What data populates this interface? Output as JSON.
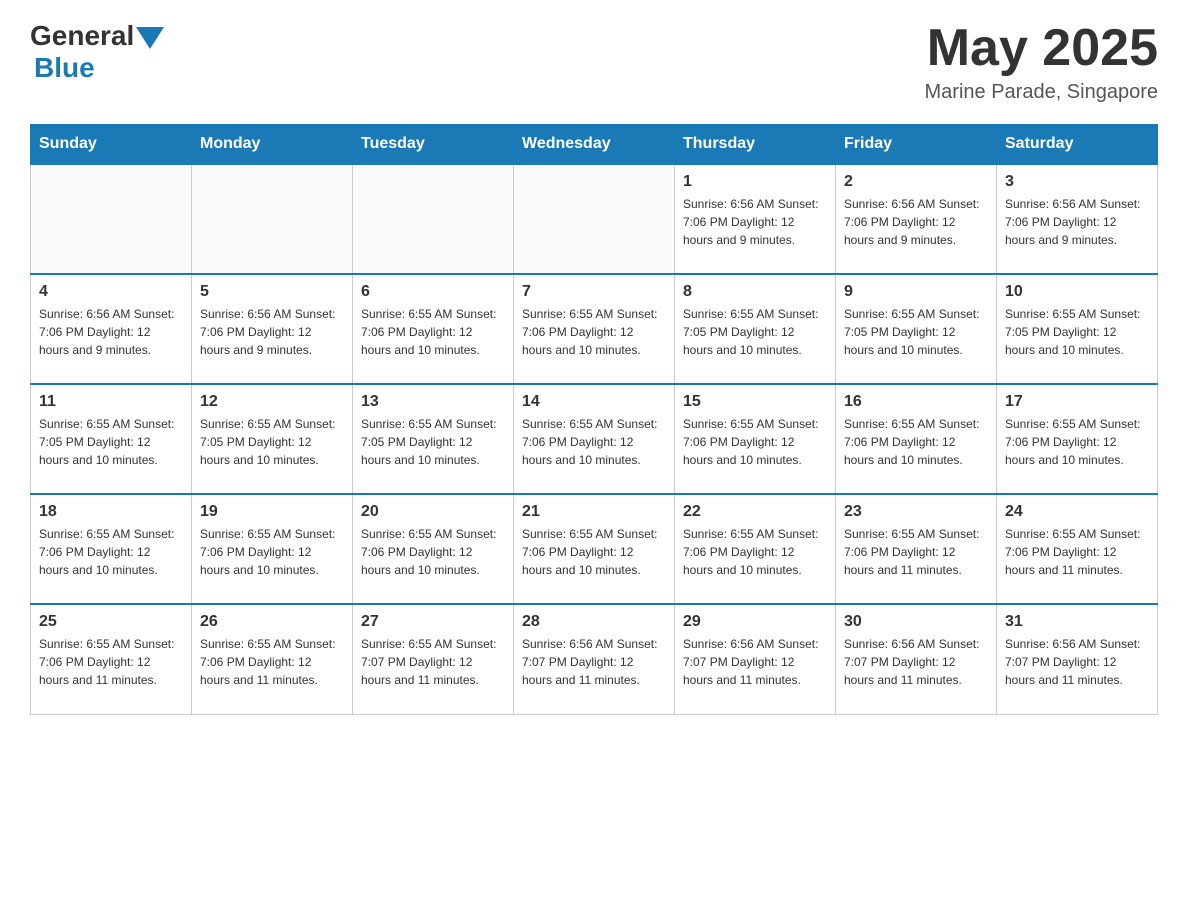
{
  "header": {
    "logo_general": "General",
    "logo_blue": "Blue",
    "month_title": "May 2025",
    "location": "Marine Parade, Singapore"
  },
  "weekdays": [
    "Sunday",
    "Monday",
    "Tuesday",
    "Wednesday",
    "Thursday",
    "Friday",
    "Saturday"
  ],
  "weeks": [
    [
      {
        "day": "",
        "info": ""
      },
      {
        "day": "",
        "info": ""
      },
      {
        "day": "",
        "info": ""
      },
      {
        "day": "",
        "info": ""
      },
      {
        "day": "1",
        "info": "Sunrise: 6:56 AM\nSunset: 7:06 PM\nDaylight: 12 hours and 9 minutes."
      },
      {
        "day": "2",
        "info": "Sunrise: 6:56 AM\nSunset: 7:06 PM\nDaylight: 12 hours and 9 minutes."
      },
      {
        "day": "3",
        "info": "Sunrise: 6:56 AM\nSunset: 7:06 PM\nDaylight: 12 hours and 9 minutes."
      }
    ],
    [
      {
        "day": "4",
        "info": "Sunrise: 6:56 AM\nSunset: 7:06 PM\nDaylight: 12 hours and 9 minutes."
      },
      {
        "day": "5",
        "info": "Sunrise: 6:56 AM\nSunset: 7:06 PM\nDaylight: 12 hours and 9 minutes."
      },
      {
        "day": "6",
        "info": "Sunrise: 6:55 AM\nSunset: 7:06 PM\nDaylight: 12 hours and 10 minutes."
      },
      {
        "day": "7",
        "info": "Sunrise: 6:55 AM\nSunset: 7:06 PM\nDaylight: 12 hours and 10 minutes."
      },
      {
        "day": "8",
        "info": "Sunrise: 6:55 AM\nSunset: 7:05 PM\nDaylight: 12 hours and 10 minutes."
      },
      {
        "day": "9",
        "info": "Sunrise: 6:55 AM\nSunset: 7:05 PM\nDaylight: 12 hours and 10 minutes."
      },
      {
        "day": "10",
        "info": "Sunrise: 6:55 AM\nSunset: 7:05 PM\nDaylight: 12 hours and 10 minutes."
      }
    ],
    [
      {
        "day": "11",
        "info": "Sunrise: 6:55 AM\nSunset: 7:05 PM\nDaylight: 12 hours and 10 minutes."
      },
      {
        "day": "12",
        "info": "Sunrise: 6:55 AM\nSunset: 7:05 PM\nDaylight: 12 hours and 10 minutes."
      },
      {
        "day": "13",
        "info": "Sunrise: 6:55 AM\nSunset: 7:05 PM\nDaylight: 12 hours and 10 minutes."
      },
      {
        "day": "14",
        "info": "Sunrise: 6:55 AM\nSunset: 7:06 PM\nDaylight: 12 hours and 10 minutes."
      },
      {
        "day": "15",
        "info": "Sunrise: 6:55 AM\nSunset: 7:06 PM\nDaylight: 12 hours and 10 minutes."
      },
      {
        "day": "16",
        "info": "Sunrise: 6:55 AM\nSunset: 7:06 PM\nDaylight: 12 hours and 10 minutes."
      },
      {
        "day": "17",
        "info": "Sunrise: 6:55 AM\nSunset: 7:06 PM\nDaylight: 12 hours and 10 minutes."
      }
    ],
    [
      {
        "day": "18",
        "info": "Sunrise: 6:55 AM\nSunset: 7:06 PM\nDaylight: 12 hours and 10 minutes."
      },
      {
        "day": "19",
        "info": "Sunrise: 6:55 AM\nSunset: 7:06 PM\nDaylight: 12 hours and 10 minutes."
      },
      {
        "day": "20",
        "info": "Sunrise: 6:55 AM\nSunset: 7:06 PM\nDaylight: 12 hours and 10 minutes."
      },
      {
        "day": "21",
        "info": "Sunrise: 6:55 AM\nSunset: 7:06 PM\nDaylight: 12 hours and 10 minutes."
      },
      {
        "day": "22",
        "info": "Sunrise: 6:55 AM\nSunset: 7:06 PM\nDaylight: 12 hours and 10 minutes."
      },
      {
        "day": "23",
        "info": "Sunrise: 6:55 AM\nSunset: 7:06 PM\nDaylight: 12 hours and 11 minutes."
      },
      {
        "day": "24",
        "info": "Sunrise: 6:55 AM\nSunset: 7:06 PM\nDaylight: 12 hours and 11 minutes."
      }
    ],
    [
      {
        "day": "25",
        "info": "Sunrise: 6:55 AM\nSunset: 7:06 PM\nDaylight: 12 hours and 11 minutes."
      },
      {
        "day": "26",
        "info": "Sunrise: 6:55 AM\nSunset: 7:06 PM\nDaylight: 12 hours and 11 minutes."
      },
      {
        "day": "27",
        "info": "Sunrise: 6:55 AM\nSunset: 7:07 PM\nDaylight: 12 hours and 11 minutes."
      },
      {
        "day": "28",
        "info": "Sunrise: 6:56 AM\nSunset: 7:07 PM\nDaylight: 12 hours and 11 minutes."
      },
      {
        "day": "29",
        "info": "Sunrise: 6:56 AM\nSunset: 7:07 PM\nDaylight: 12 hours and 11 minutes."
      },
      {
        "day": "30",
        "info": "Sunrise: 6:56 AM\nSunset: 7:07 PM\nDaylight: 12 hours and 11 minutes."
      },
      {
        "day": "31",
        "info": "Sunrise: 6:56 AM\nSunset: 7:07 PM\nDaylight: 12 hours and 11 minutes."
      }
    ]
  ]
}
